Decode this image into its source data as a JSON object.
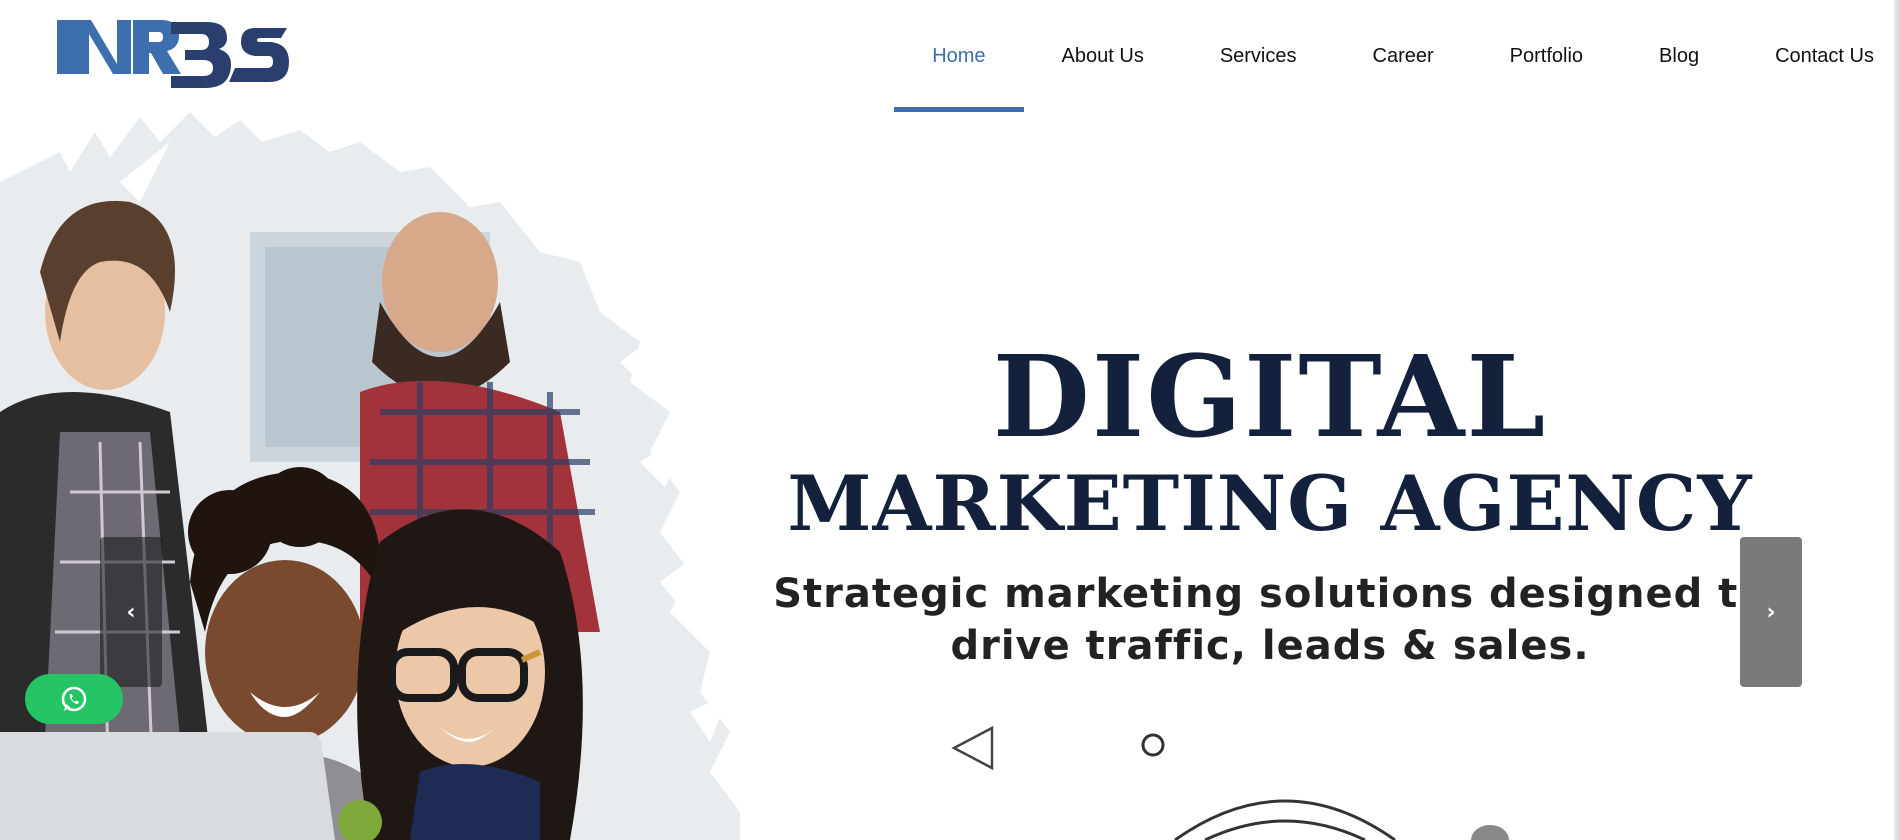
{
  "brand": {
    "logo_text": "NRBS",
    "primary_color": "#3d6fae",
    "dark_color": "#2a3f6e"
  },
  "nav": {
    "items": [
      {
        "label": "Home",
        "active": true
      },
      {
        "label": "About Us",
        "active": false
      },
      {
        "label": "Services",
        "active": false
      },
      {
        "label": "Career",
        "active": false
      },
      {
        "label": "Portfolio",
        "active": false
      },
      {
        "label": "Blog",
        "active": false
      },
      {
        "label": "Contact Us",
        "active": false
      }
    ],
    "active_color": "#3d6fae"
  },
  "hero": {
    "title_line1": "DIGITAL",
    "title_line2": "MARKETING AGENCY",
    "subtitle_line1": "Strategic marketing solutions designed to",
    "subtitle_line2": "drive traffic, leads & sales.",
    "title_color": "#14213d",
    "prev_icon": "chevron-left-icon",
    "next_icon": "chevron-right-icon"
  },
  "whatsapp": {
    "icon": "whatsapp-icon",
    "color": "#25c464"
  }
}
